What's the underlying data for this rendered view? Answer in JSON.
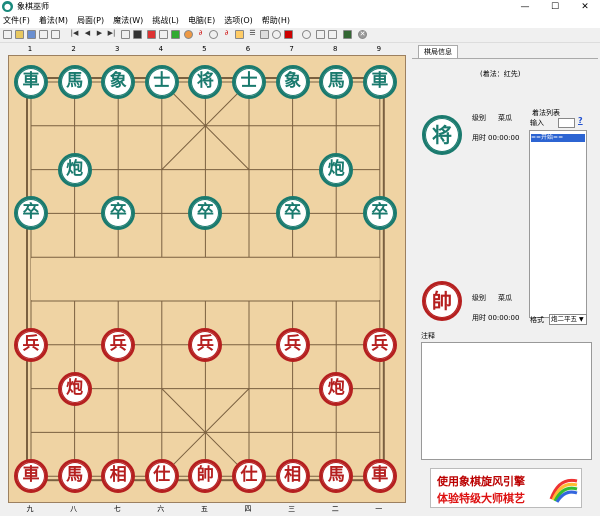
{
  "window": {
    "title": "象棋巫师",
    "minimize": "—",
    "maximize": "☐",
    "close": "✕"
  },
  "menu": [
    "文件(F)",
    "着法(M)",
    "局面(P)",
    "魔法(W)",
    "挑战(L)",
    "电脑(E)",
    "选项(O)",
    "帮助(H)"
  ],
  "ruler_top": [
    "1",
    "2",
    "3",
    "4",
    "5",
    "6",
    "7",
    "8",
    "9"
  ],
  "ruler_bottom": [
    "九",
    "八",
    "七",
    "六",
    "五",
    "四",
    "三",
    "二",
    "一"
  ],
  "pieces": [
    {
      "t": "車",
      "s": "green",
      "c": 0,
      "r": 0
    },
    {
      "t": "馬",
      "s": "green",
      "c": 1,
      "r": 0
    },
    {
      "t": "象",
      "s": "green",
      "c": 2,
      "r": 0
    },
    {
      "t": "士",
      "s": "green",
      "c": 3,
      "r": 0
    },
    {
      "t": "将",
      "s": "green",
      "c": 4,
      "r": 0
    },
    {
      "t": "士",
      "s": "green",
      "c": 5,
      "r": 0
    },
    {
      "t": "象",
      "s": "green",
      "c": 6,
      "r": 0
    },
    {
      "t": "馬",
      "s": "green",
      "c": 7,
      "r": 0
    },
    {
      "t": "車",
      "s": "green",
      "c": 8,
      "r": 0
    },
    {
      "t": "炮",
      "s": "green",
      "c": 1,
      "r": 2
    },
    {
      "t": "炮",
      "s": "green",
      "c": 7,
      "r": 2
    },
    {
      "t": "卒",
      "s": "green",
      "c": 0,
      "r": 3
    },
    {
      "t": "卒",
      "s": "green",
      "c": 2,
      "r": 3
    },
    {
      "t": "卒",
      "s": "green",
      "c": 4,
      "r": 3
    },
    {
      "t": "卒",
      "s": "green",
      "c": 6,
      "r": 3
    },
    {
      "t": "卒",
      "s": "green",
      "c": 8,
      "r": 3
    },
    {
      "t": "兵",
      "s": "red",
      "c": 0,
      "r": 6
    },
    {
      "t": "兵",
      "s": "red",
      "c": 2,
      "r": 6
    },
    {
      "t": "兵",
      "s": "red",
      "c": 4,
      "r": 6
    },
    {
      "t": "兵",
      "s": "red",
      "c": 6,
      "r": 6
    },
    {
      "t": "兵",
      "s": "red",
      "c": 8,
      "r": 6
    },
    {
      "t": "炮",
      "s": "red",
      "c": 1,
      "r": 7
    },
    {
      "t": "炮",
      "s": "red",
      "c": 7,
      "r": 7
    },
    {
      "t": "車",
      "s": "red",
      "c": 0,
      "r": 9
    },
    {
      "t": "馬",
      "s": "red",
      "c": 1,
      "r": 9
    },
    {
      "t": "相",
      "s": "red",
      "c": 2,
      "r": 9
    },
    {
      "t": "仕",
      "s": "red",
      "c": 3,
      "r": 9
    },
    {
      "t": "帥",
      "s": "red",
      "c": 4,
      "r": 9
    },
    {
      "t": "仕",
      "s": "red",
      "c": 5,
      "r": 9
    },
    {
      "t": "相",
      "s": "red",
      "c": 6,
      "r": 9
    },
    {
      "t": "馬",
      "s": "red",
      "c": 7,
      "r": 9
    },
    {
      "t": "車",
      "s": "red",
      "c": 8,
      "r": 9
    }
  ],
  "panel": {
    "tab": "棋局信息",
    "heading": "(着法：红先)",
    "black_piece": "将",
    "red_piece": "帥",
    "level_label": "级别",
    "level_value": "菜瓜",
    "time_label": "用时",
    "black_time": "00:00:00",
    "red_time": "00:00:00",
    "movelist_label": "着法列表",
    "input_label": "输入",
    "help_icon": "?",
    "movelist_selected": "==开始==",
    "format_label": "格式",
    "format_value": "炮二平五",
    "notes_label": "注释",
    "banner_line1": "使用象棋旋风引擎",
    "banner_line2": "体验特级大师棋艺"
  },
  "colors": {
    "board": "#efd3a3",
    "green": "#1a7a6e",
    "red": "#b51f1f",
    "line": "#7a6040"
  }
}
